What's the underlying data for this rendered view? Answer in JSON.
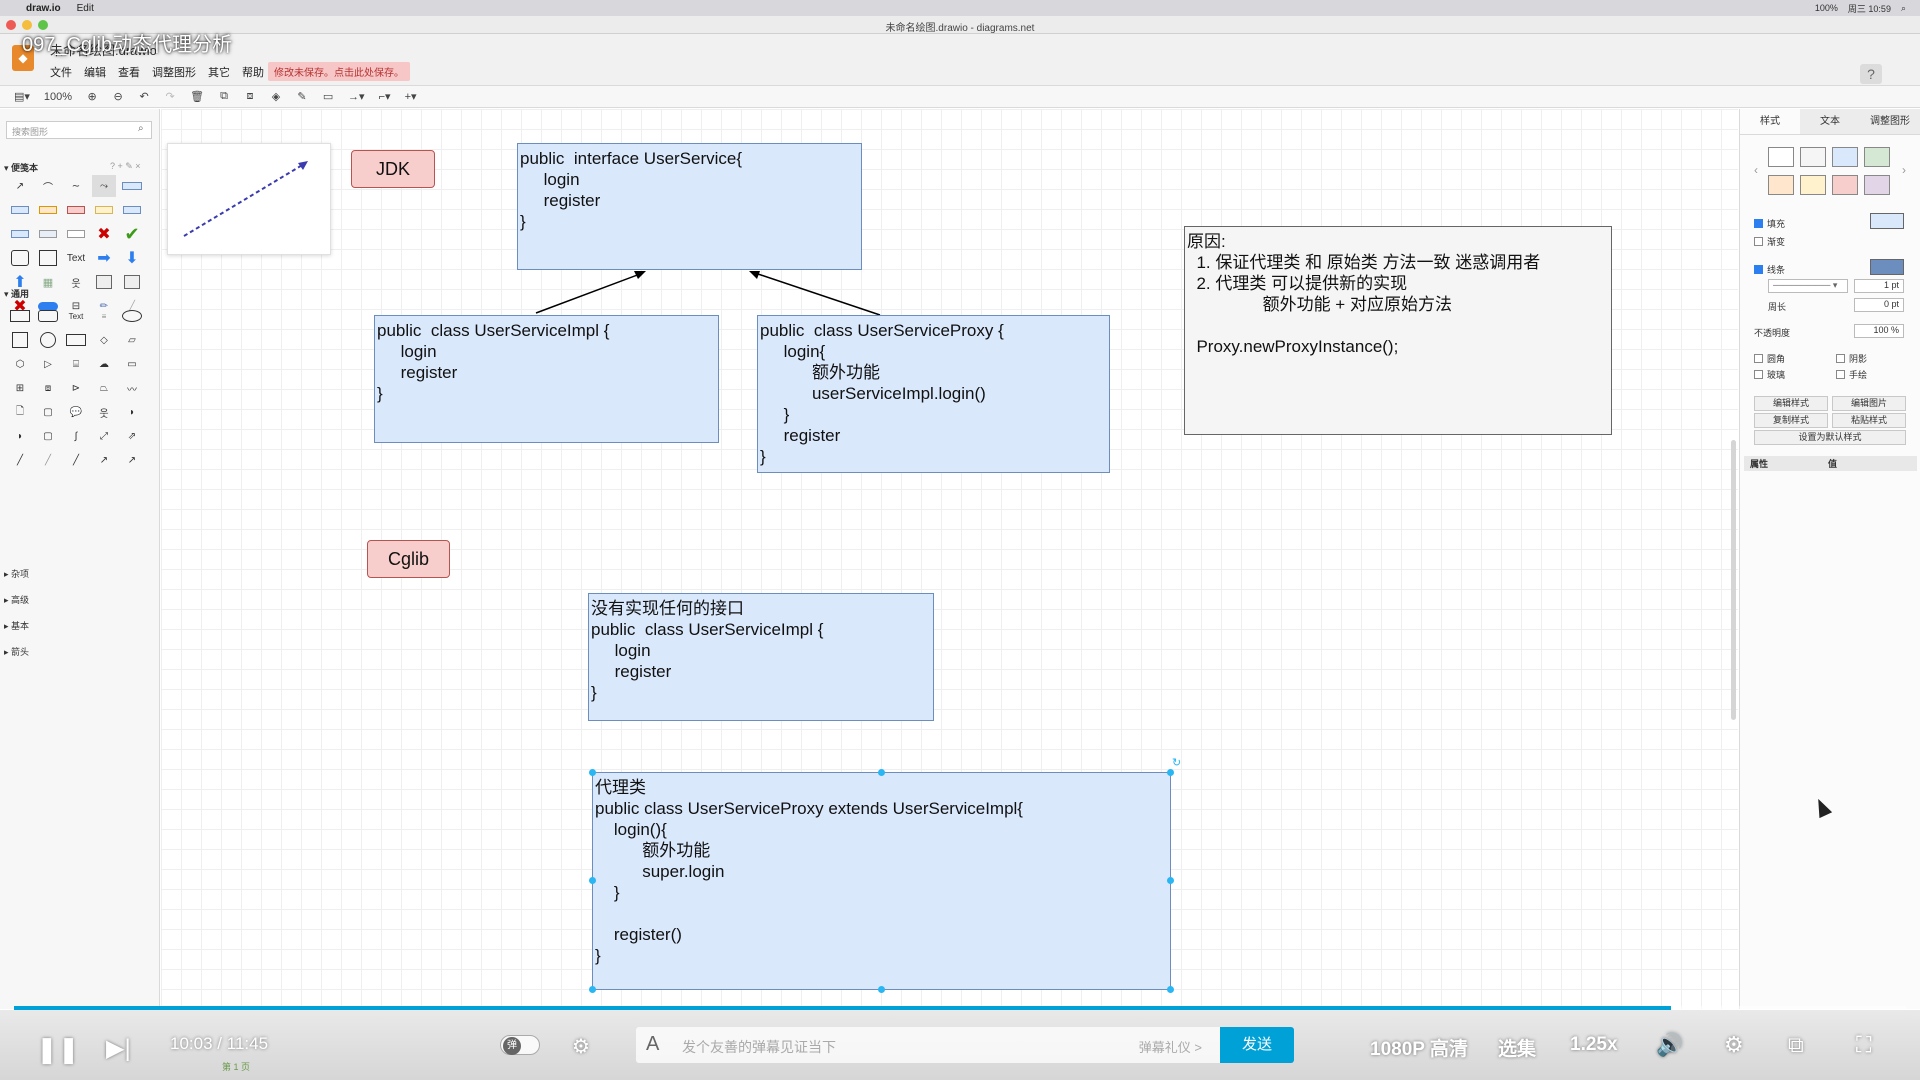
{
  "menubar": {
    "app": "draw.io",
    "items": [
      "Edit"
    ],
    "status": "100%",
    "clock": "周三 10:59"
  },
  "window": {
    "center_title": "未命名绘图.drawio - diagrams.net"
  },
  "video": {
    "title": "097_Cglib动态代理分析"
  },
  "app": {
    "doc_title": "未命名绘图.drawio",
    "menu": [
      "文件",
      "编辑",
      "查看",
      "调整图形",
      "其它",
      "帮助"
    ],
    "unsaved_notice": "修改未保存。点击此处保存。",
    "zoom": "100%"
  },
  "sidebar": {
    "search_placeholder": "搜索图形",
    "scratchpad_title": "便笺本",
    "general_title": "通用",
    "text_shape_label": "Text",
    "sections": [
      "杂项",
      "高级",
      "基本",
      "箭头"
    ]
  },
  "diagram": {
    "jdk_label": "JDK",
    "cglib_label": "Cglib",
    "interface_box": "public  interface UserService{\n     login\n     register\n}",
    "impl_box": "public  class UserServiceImpl {\n     login\n     register\n}",
    "proxy_box": "public  class UserServiceProxy {\n     login{\n           额外功能\n           userServiceImpl.login()\n     }\n     register\n}",
    "note_box": "原因:\n  1. 保证代理类 和 原始类 方法一致 迷惑调用者\n  2. 代理类 可以提供新的实现\n                额外功能 + 对应原始方法\n\n  Proxy.newProxyInstance();",
    "cglib_impl_box": "没有实现任何的接口\npublic  class UserServiceImpl {\n     login\n     register\n}",
    "cglib_proxy_box": "代理类\npublic class UserServiceProxy extends UserServiceImpl{\n    login(){\n          额外功能\n          super.login\n    }\n\n    register()\n}"
  },
  "format_panel": {
    "tabs": [
      "样式",
      "文本",
      "调整图形"
    ],
    "fill_label": "填充",
    "gradient_label": "渐变",
    "line_label": "线条",
    "line_width": "1 pt",
    "perimeter_label": "周长",
    "perimeter_value": "0 pt",
    "opacity_label": "不透明度",
    "opacity_value": "100 %",
    "rounded_label": "圆角",
    "shadow_label": "阴影",
    "glass_label": "玻璃",
    "sketch_label": "手绘",
    "edit_style": "编辑样式",
    "edit_image": "编辑图片",
    "copy_style": "复制样式",
    "paste_style": "粘贴样式",
    "set_default": "设置为默认样式",
    "prop_col": "属性",
    "value_col": "值",
    "swatch_colors": [
      "#ffffff",
      "#f5f5f5",
      "#dae8fc",
      "#d5e8d4",
      "#ffe6cc",
      "#fff2cc",
      "#f8cecc",
      "#e1d5e7"
    ]
  },
  "player": {
    "time_current": "10:03",
    "time_sep": "/",
    "time_total": "11:45",
    "progress": 0.8756,
    "danmaku_placeholder": "发个友善的弹幕见证当下",
    "danmaku_etiquette": "弹幕礼仪 >",
    "send_label": "发送",
    "quality": "1080P 高清",
    "episodes": "选集",
    "speed": "1.25x",
    "page_tab": "第 1 页"
  },
  "colors": {
    "accent": "#00a1d6",
    "box_fill": "#dae8fc",
    "box_stroke": "#6c8ebf",
    "label_fill": "#f8cecc",
    "label_stroke": "#b85450"
  }
}
